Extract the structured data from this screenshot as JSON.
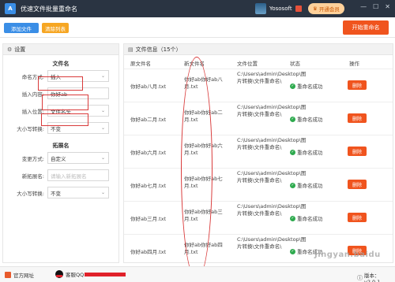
{
  "titlebar": {
    "app_title": "优速文件批量重命名",
    "logo_text": "A",
    "user_name": "Yososoft",
    "vip_button": "开通会员",
    "controls": {
      "minimize": "—",
      "maximize": "☐",
      "close": "✕"
    }
  },
  "toolbar": {
    "add_files": "添加文件",
    "clear_list": "清除列表",
    "start_rename": "开始重命名"
  },
  "settings": {
    "panel_title": "设置",
    "filename_section": "文件名",
    "rename_mode_label": "命名方式:",
    "rename_mode_value": "插入",
    "insert_content_label": "插入内容:",
    "insert_content_value": "你好ab",
    "insert_position_label": "插入位置:",
    "insert_position_value": "文件名头",
    "case_label": "大小写转换:",
    "case_value": "不变",
    "ext_section": "拓展名",
    "ext_mode_label": "变更方式:",
    "ext_mode_value": "自定义",
    "new_ext_label": "新拓展名:",
    "new_ext_placeholder": "请输入新拓展名",
    "ext_case_label": "大小写转换:",
    "ext_case_value": "不变"
  },
  "file_list": {
    "title": "文件信息（15个）",
    "headers": [
      "原文件名",
      "新文件名",
      "文件位置",
      "状态",
      "操作"
    ],
    "rows": [
      {
        "orig": "你好ab八月.txt",
        "new": "你好ab你好ab八月.txt",
        "location": "C:\\Users\\admin\\Desktop\\图片转换\\文件重命名\\",
        "status": "重命名成功",
        "action": "删除"
      },
      {
        "orig": "你好ab二月.txt",
        "new": "你好ab你好ab二月.txt",
        "location": "C:\\Users\\admin\\Desktop\\图片转换\\文件重命名\\",
        "status": "重命名成功",
        "action": "删除"
      },
      {
        "orig": "你好ab六月.txt",
        "new": "你好ab你好ab六月.txt",
        "location": "C:\\Users\\admin\\Desktop\\图片转换\\文件重命名\\",
        "status": "重命名成功",
        "action": "删除"
      },
      {
        "orig": "你好ab七月.txt",
        "new": "你好ab你好ab七月.txt",
        "location": "C:\\Users\\admin\\Desktop\\图片转换\\文件重命名\\",
        "status": "重命名成功",
        "action": "删除"
      },
      {
        "orig": "你好ab三月.txt",
        "new": "你好ab你好ab三月.txt",
        "location": "C:\\Users\\admin\\Desktop\\图片转换\\文件重命名\\",
        "status": "重命名成功",
        "action": "删除"
      },
      {
        "orig": "你好ab四月.txt",
        "new": "你好ab你好ab四月.txt",
        "location": "C:\\Users\\admin\\Desktop\\图片转换\\文件重命名\\",
        "status": "重命名成功",
        "action": "删除"
      }
    ]
  },
  "statusbar": {
    "website": "官方网址",
    "qq": "客服QQ",
    "version": "版本：v2.0.1"
  },
  "watermark": "Jingyan.baidu",
  "colors": {
    "primary": "#3a8ee6",
    "danger": "#f0541e",
    "warning": "#f6a623",
    "success": "#2eaa4e",
    "titlebar": "#2a3442",
    "annotation": "#d93a3a"
  }
}
